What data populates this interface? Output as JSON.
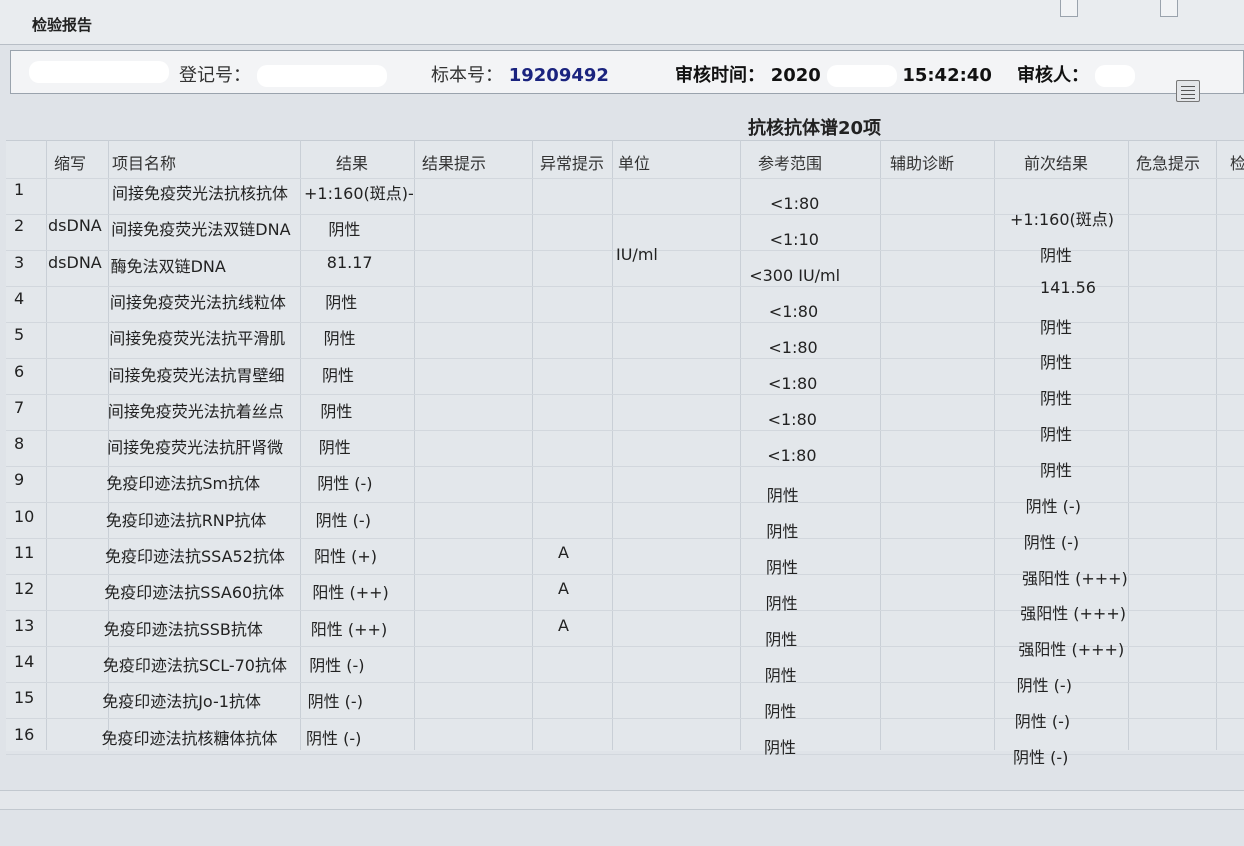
{
  "window": {
    "title": "检验报告",
    "tabs": [
      "",
      ""
    ]
  },
  "info": {
    "reg_label": "登记号：",
    "specimen_label": "标本号：",
    "specimen_value": "19209492",
    "audit_time_label": "审核时间：",
    "audit_time_date": "2020",
    "audit_time_clock": "15:42:40",
    "auditor_label": "审核人："
  },
  "group_title": "抗核抗体谱20项",
  "headers": {
    "abbr": "缩写",
    "name": "项目名称",
    "result": "结果",
    "result_hint": "结果提示",
    "abnormal": "异常提示",
    "unit": "单位",
    "ref": "参考范围",
    "aux": "辅助诊断",
    "prev": "前次结果",
    "critical": "危急提示",
    "extra": "检"
  },
  "rows": [
    {
      "n": "1",
      "abbr": "",
      "name": "间接免疫荧光法抗核抗体",
      "result": "+1:160(斑点)-",
      "abnormal": "",
      "unit": "",
      "ref": "<1:80",
      "prev": "+1:160(斑点)"
    },
    {
      "n": "2",
      "abbr": "dsDNA",
      "name": "间接免疫荧光法双链DNA",
      "result": "阴性",
      "abnormal": "",
      "unit": "",
      "ref": "<1:10",
      "prev": "阴性"
    },
    {
      "n": "3",
      "abbr": "dsDNA",
      "name": "酶免法双链DNA",
      "result": "81.17",
      "abnormal": "",
      "unit": "IU/ml",
      "ref": "<300 IU/ml",
      "prev": "141.56"
    },
    {
      "n": "4",
      "abbr": "",
      "name": "间接免疫荧光法抗线粒体",
      "result": "阴性",
      "abnormal": "",
      "unit": "",
      "ref": "<1:80",
      "prev": "阴性"
    },
    {
      "n": "5",
      "abbr": "",
      "name": "间接免疫荧光法抗平滑肌",
      "result": "阴性",
      "abnormal": "",
      "unit": "",
      "ref": "<1:80",
      "prev": "阴性"
    },
    {
      "n": "6",
      "abbr": "",
      "name": "间接免疫荧光法抗胃壁细",
      "result": "阴性",
      "abnormal": "",
      "unit": "",
      "ref": "<1:80",
      "prev": "阴性"
    },
    {
      "n": "7",
      "abbr": "",
      "name": "间接免疫荧光法抗着丝点",
      "result": "阴性",
      "abnormal": "",
      "unit": "",
      "ref": "<1:80",
      "prev": "阴性"
    },
    {
      "n": "8",
      "abbr": "",
      "name": "间接免疫荧光法抗肝肾微",
      "result": "阴性",
      "abnormal": "",
      "unit": "",
      "ref": "<1:80",
      "prev": "阴性"
    },
    {
      "n": "9",
      "abbr": "",
      "name": "免疫印迹法抗Sm抗体",
      "result": "阴性 (-)",
      "abnormal": "",
      "unit": "",
      "ref": "阴性",
      "prev": "阴性 (-)"
    },
    {
      "n": "10",
      "abbr": "",
      "name": "免疫印迹法抗RNP抗体",
      "result": "阴性 (-)",
      "abnormal": "",
      "unit": "",
      "ref": "阴性",
      "prev": "阴性 (-)"
    },
    {
      "n": "11",
      "abbr": "",
      "name": "免疫印迹法抗SSA52抗体",
      "result": "阳性 (+)",
      "abnormal": "A",
      "unit": "",
      "ref": "阴性",
      "prev": "强阳性 (+++)"
    },
    {
      "n": "12",
      "abbr": "",
      "name": "免疫印迹法抗SSA60抗体",
      "result": "阳性 (++)",
      "abnormal": "A",
      "unit": "",
      "ref": "阴性",
      "prev": "强阳性 (+++)"
    },
    {
      "n": "13",
      "abbr": "",
      "name": "免疫印迹法抗SSB抗体",
      "result": "阳性 (++)",
      "abnormal": "A",
      "unit": "",
      "ref": "阴性",
      "prev": "强阳性 (+++)"
    },
    {
      "n": "14",
      "abbr": "",
      "name": "免疫印迹法抗SCL-70抗体",
      "result": "阴性 (-)",
      "abnormal": "",
      "unit": "",
      "ref": "阴性",
      "prev": "阴性 (-)"
    },
    {
      "n": "15",
      "abbr": "",
      "name": "免疫印迹法抗Jo-1抗体",
      "result": "阴性 (-)",
      "abnormal": "",
      "unit": "",
      "ref": "阴性",
      "prev": "阴性 (-)"
    },
    {
      "n": "16",
      "abbr": "",
      "name": "免疫印迹法抗核糖体抗体",
      "result": "阴性 (-)",
      "abnormal": "",
      "unit": "",
      "ref": "阴性",
      "prev": "阴性 (-)"
    }
  ]
}
